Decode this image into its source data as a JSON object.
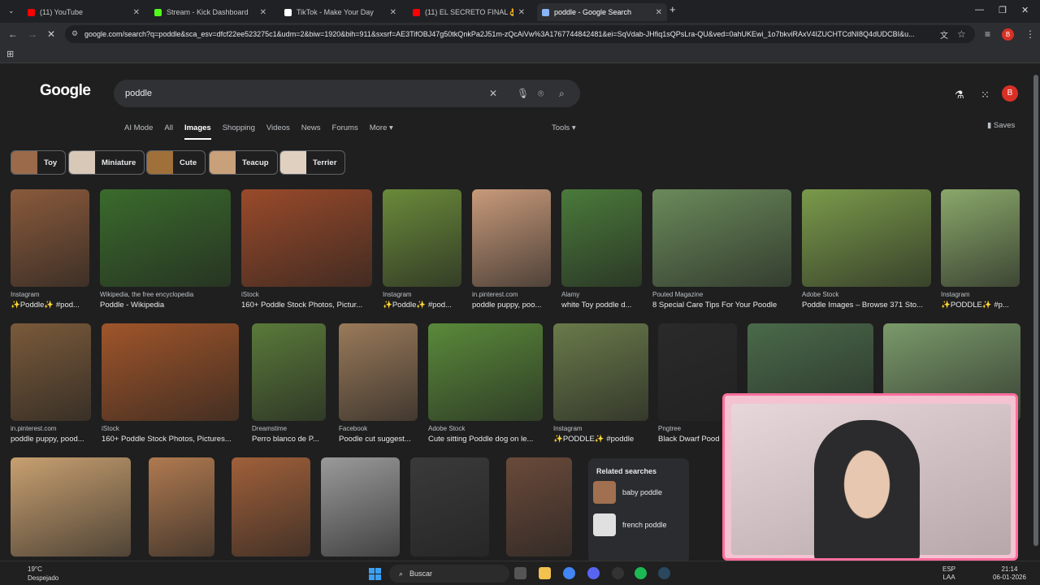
{
  "browser": {
    "tabs": [
      {
        "title": "(11) YouTube",
        "color": "#ff0000",
        "active": false
      },
      {
        "title": "Stream - Kick Dashboard",
        "color": "#53fc18",
        "active": false
      },
      {
        "title": "TikTok - Make Your Day",
        "color": "#ffffff",
        "active": false
      },
      {
        "title": "(11) EL SECRETO FINAL👌 Cap",
        "color": "#ff0000",
        "active": false
      },
      {
        "title": "poddle - Google Search",
        "color": "#8ab4f8",
        "active": true
      }
    ],
    "new_tab": "+",
    "url": "google.com/search?q=poddle&sca_esv=dfcf22ee523275c1&udm=2&biw=1920&bih=911&sxsrf=AE3TifOBJ47g50tkQnkPa2J51m-zQcAiVw%3A1767744842481&ei=SqVdab-JHfiq1sQPsLra-QU&ved=0ahUKEwi_1o7bkviRAxV4IZUCHTCdNI8Q4dUDCBI&u...",
    "avatar_letter": "B"
  },
  "google": {
    "logo": "Google",
    "query": "poddle",
    "tabs": [
      "AI Mode",
      "All",
      "Images",
      "Shopping",
      "Videos",
      "News",
      "Forums",
      "More ▾"
    ],
    "active_tab": "Images",
    "tools": "Tools ▾",
    "saves": "Saves",
    "avatar_letter": "B",
    "chips": [
      "Toy",
      "Miniature",
      "Cute",
      "Teacup",
      "Terrier"
    ],
    "results_row1": [
      {
        "source": "Instagram",
        "caption": "✨Poddle✨ #pod...",
        "color": "#8a5a3b"
      },
      {
        "source": "Wikipedia, the free encyclopedia",
        "caption": "Poddle - Wikipedia",
        "color": "#3a6b2c"
      },
      {
        "source": "iStock",
        "caption": "160+ Poddle Stock Photos, Pictur...",
        "color": "#9a4a2a"
      },
      {
        "source": "Instagram",
        "caption": "✨Poddle✨ #pod...",
        "color": "#6a8a3a"
      },
      {
        "source": "in.pinterest.com",
        "caption": "poddle puppy, poo...",
        "color": "#c89a7a"
      },
      {
        "source": "Alamy",
        "caption": "white Toy poddle d...",
        "color": "#4a7a3a"
      },
      {
        "source": "Pouted Magazine",
        "caption": "8 Special Care Tips For Your Poodle",
        "color": "#6a8a5a"
      },
      {
        "source": "Adobe Stock",
        "caption": "Poddle Images – Browse 371 Sto...",
        "color": "#7a9a4a"
      },
      {
        "source": "Instagram",
        "caption": "✨PODDLE✨ #p...",
        "color": "#8aa86a"
      }
    ],
    "results_row2": [
      {
        "source": "in.pinterest.com",
        "caption": "poddle puppy, pood...",
        "color": "#7a5a3a"
      },
      {
        "source": "iStock",
        "caption": "160+ Poddle Stock Photos, Pictures...",
        "color": "#a0552a"
      },
      {
        "source": "Dreamstime",
        "caption": "Perro blanco de P...",
        "color": "#5a7a3a"
      },
      {
        "source": "Facebook",
        "caption": "Poodle cut suggest...",
        "color": "#9a7a5a"
      },
      {
        "source": "Adobe Stock",
        "caption": "Cute sitting Poddle dog on le...",
        "color": "#5a8a3a"
      },
      {
        "source": "Instagram",
        "caption": "✨PODDLE✨ #poddle",
        "color": "#6a7a4a"
      },
      {
        "source": "Pngtree",
        "caption": "Black Dwarf Pood",
        "color": "#2a2a2a"
      },
      {
        "source": "",
        "caption": "",
        "color": "#4a6a4a"
      },
      {
        "source": "",
        "caption": "",
        "color": "#7a9a6a"
      }
    ],
    "results_row3": [
      {
        "color": "#c8a070"
      },
      {
        "color": "#b07a50"
      },
      {
        "color": "#a0603a"
      },
      {
        "color": "#9a9a9a"
      },
      {
        "color": "#3a3a3a"
      },
      {
        "color": "#6a4a3a"
      }
    ],
    "related": {
      "heading": "Related searches",
      "items": [
        "baby poddle",
        "french poddle"
      ]
    }
  },
  "taskbar": {
    "weather_temp": "19°C",
    "weather_desc": "Despejado",
    "search_placeholder": "Buscar",
    "lang1": "ESP",
    "lang2": "LAA",
    "time": "21:14",
    "date": "06-01-2026"
  }
}
